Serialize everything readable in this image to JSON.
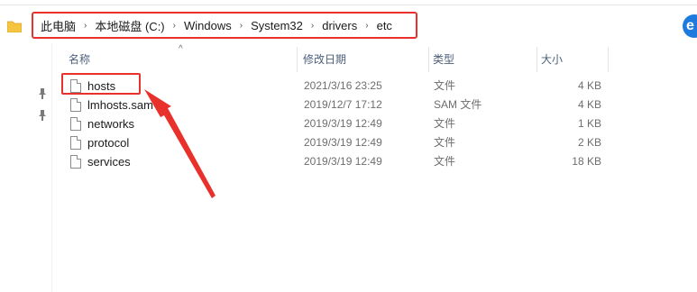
{
  "address_bar": {
    "crumbs": [
      "此电脑",
      "本地磁盘 (C:)",
      "Windows",
      "System32",
      "drivers",
      "etc"
    ],
    "separator": "›"
  },
  "columns": {
    "name": "名称",
    "date": "修改日期",
    "type": "类型",
    "size": "大小",
    "sort_indicator": "^"
  },
  "files": [
    {
      "name": "hosts",
      "date": "2021/3/16 23:25",
      "type": "文件",
      "size": "4 KB"
    },
    {
      "name": "lmhosts.sam",
      "date": "2019/12/7 17:12",
      "type": "SAM 文件",
      "size": "4 KB"
    },
    {
      "name": "networks",
      "date": "2019/3/19 12:49",
      "type": "文件",
      "size": "1 KB"
    },
    {
      "name": "protocol",
      "date": "2019/3/19 12:49",
      "type": "文件",
      "size": "2 KB"
    },
    {
      "name": "services",
      "date": "2019/3/19 12:49",
      "type": "文件",
      "size": "18 KB"
    }
  ],
  "icons": {
    "folder": "folder-icon",
    "file": "file-icon",
    "pin": "pin-icon",
    "browser_badge": "edge-icon"
  },
  "colors": {
    "annotation_red": "#e8312b",
    "header_text": "#4c607a"
  }
}
